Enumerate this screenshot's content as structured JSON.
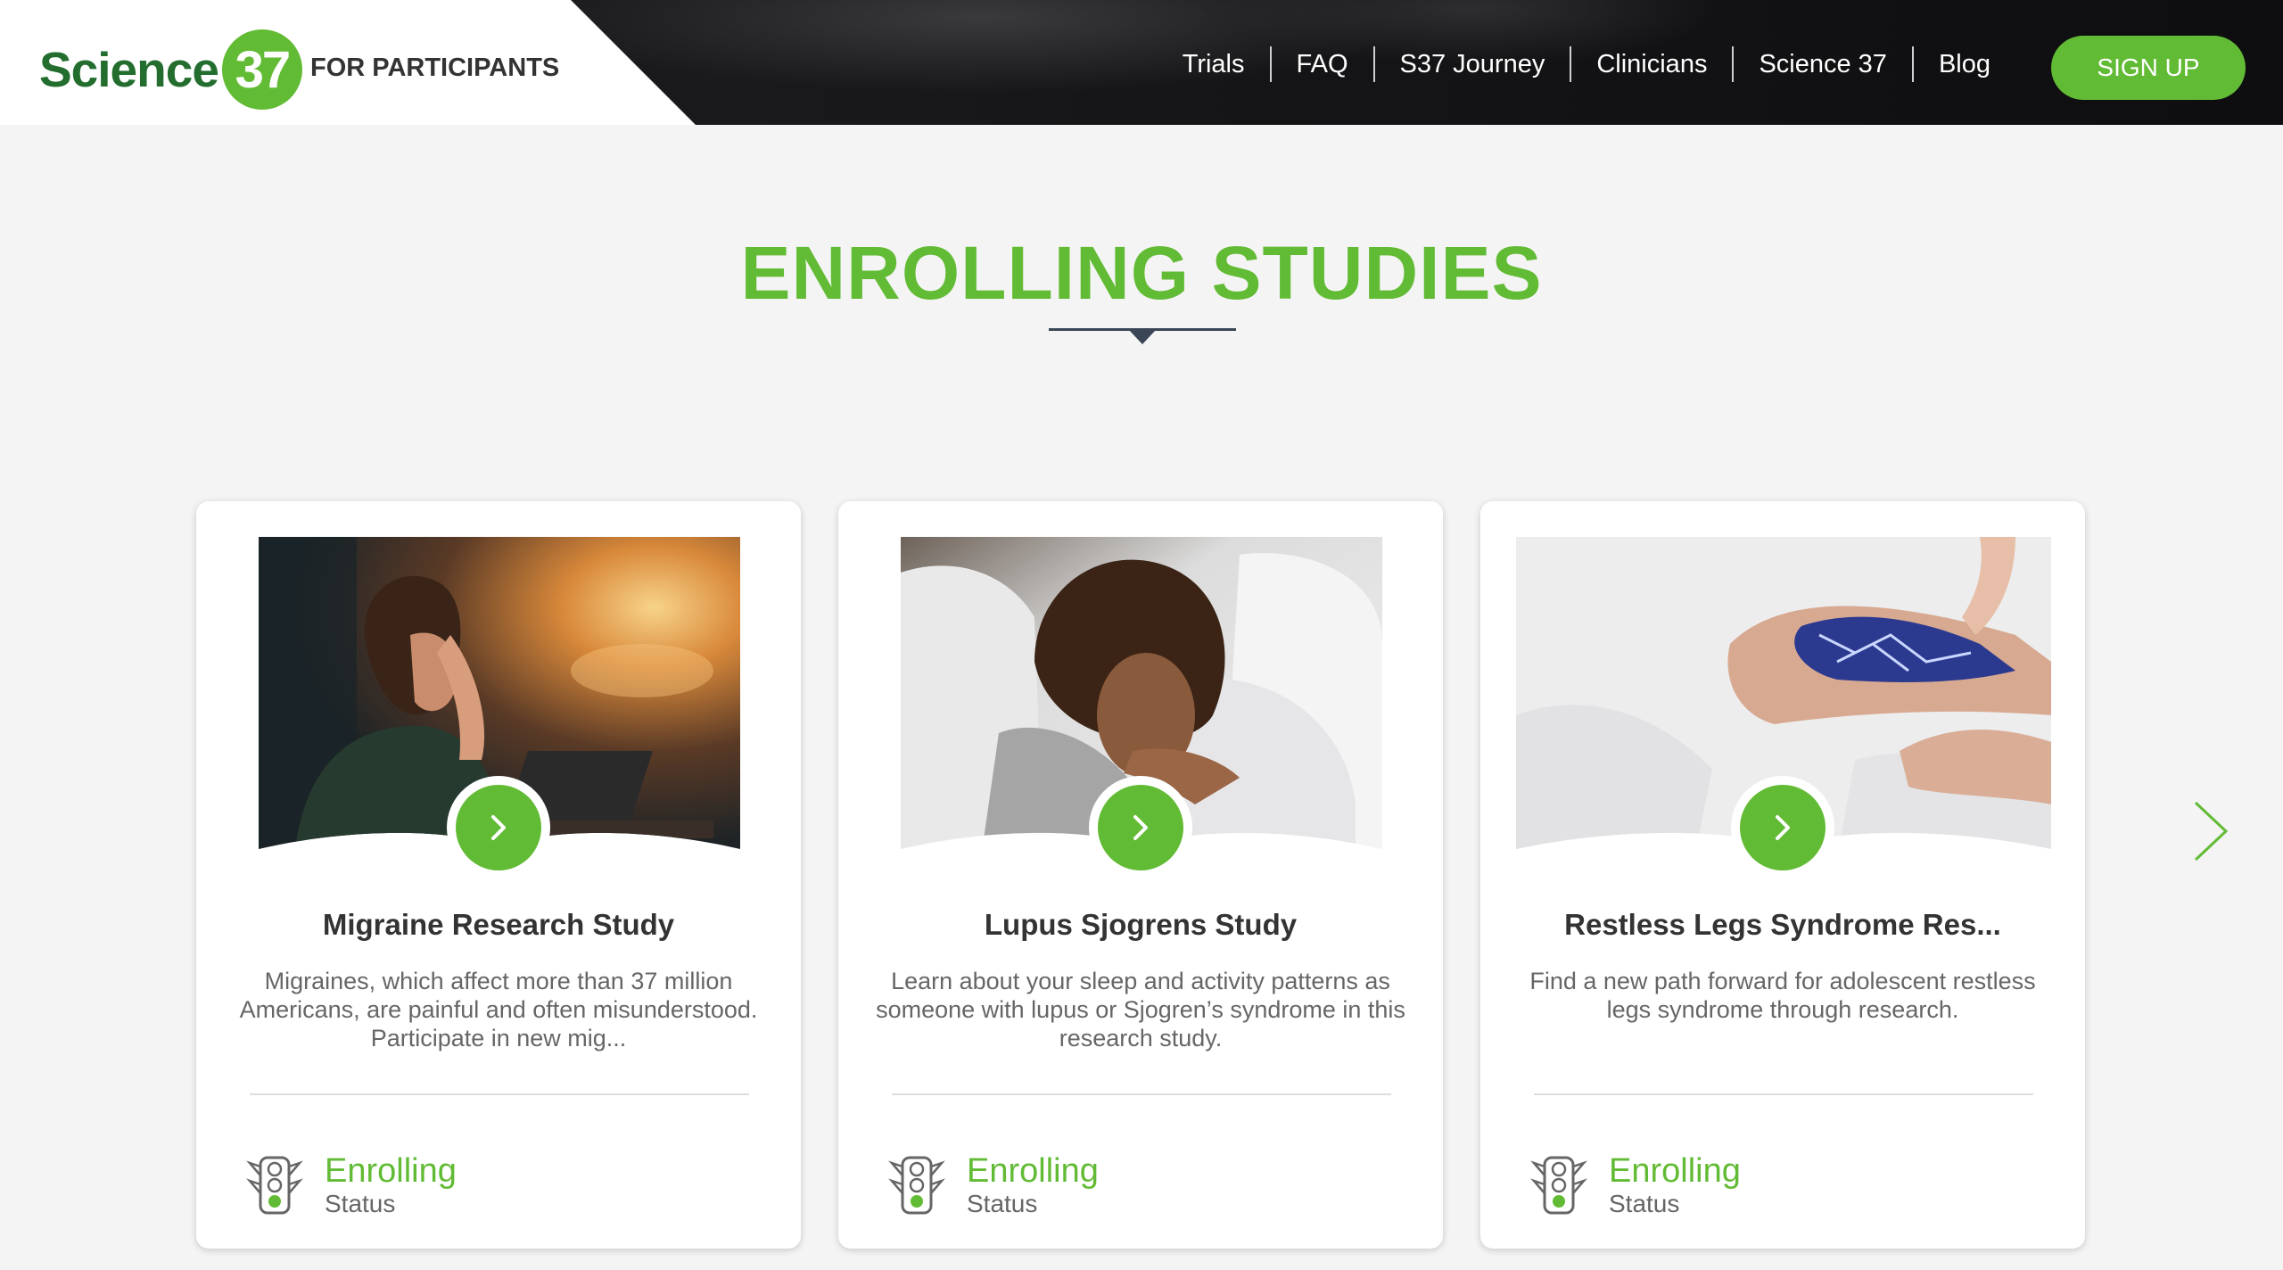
{
  "header": {
    "logo_text": "Science",
    "logo_number": "37",
    "tagline": "FOR PARTICIPANTS",
    "nav": [
      "Trials",
      "FAQ",
      "S37 Journey",
      "Clinicians",
      "Science 37",
      "Blog"
    ],
    "signup_label": "SIGN UP"
  },
  "section": {
    "title": "ENROLLING STUDIES"
  },
  "cards": [
    {
      "title": "Migraine Research Study",
      "description": "Migraines, which affect more than 37 million Americans, are painful and often misunderstood. Participate in new mig...",
      "status_value": "Enrolling",
      "status_label": "Status",
      "image": "woman-headache-at-laptop"
    },
    {
      "title": "Lupus Sjogrens Study",
      "description": "Learn about your sleep and activity patterns as someone with lupus or Sjogren’s syndrome in this research study.",
      "status_value": "Enrolling",
      "status_label": "Status",
      "image": "woman-sleeping-in-bed"
    },
    {
      "title": "Restless Legs Syndrome Res...",
      "description": "Find a new path forward for adolescent restless legs syndrome through research.",
      "status_value": "Enrolling",
      "status_label": "Status",
      "image": "legs-with-electric-nerves"
    }
  ],
  "colors": {
    "brand_green": "#62bb34",
    "logo_green": "#236d2f",
    "header_dark": "#17171a"
  },
  "icons": [
    "chevron-right-icon",
    "traffic-light-icon",
    "carousel-next-icon"
  ]
}
